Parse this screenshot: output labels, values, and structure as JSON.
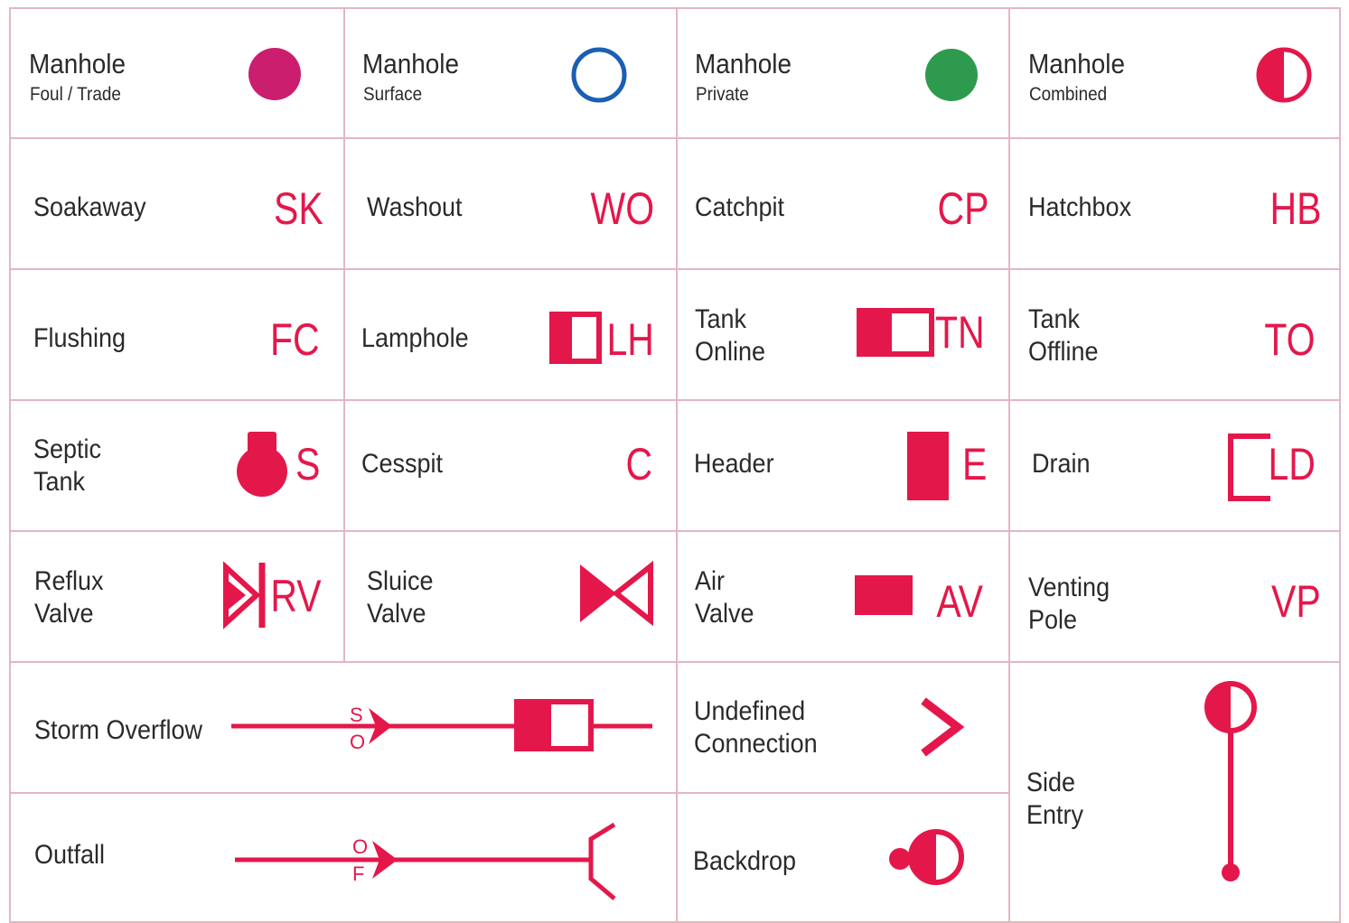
{
  "colors": {
    "symbol_red": "#e4174b",
    "foul_magenta": "#cc1e6e",
    "surface_blue": "#1a5fb4",
    "private_green": "#2e9a4e",
    "grid_line": "#e2b7c2",
    "text": "#2a2a2a"
  },
  "cells": {
    "manhole_foul": {
      "title": "Manhole",
      "subtitle": "Foul / Trade",
      "icon": "filled-circle-icon"
    },
    "manhole_surface": {
      "title": "Manhole",
      "subtitle": "Surface",
      "icon": "ring-circle-icon"
    },
    "manhole_private": {
      "title": "Manhole",
      "subtitle": "Private",
      "icon": "filled-circle-icon"
    },
    "manhole_combined": {
      "title": "Manhole",
      "subtitle": "Combined",
      "icon": "half-filled-circle-icon"
    },
    "soakaway": {
      "label": "Soakaway",
      "code": "SK"
    },
    "washout": {
      "label": "Washout",
      "code": "WO"
    },
    "catchpit": {
      "label": "Catchpit",
      "code": "CP"
    },
    "hatchbox": {
      "label": "Hatchbox",
      "code": "HB"
    },
    "flushing": {
      "label": "Flushing",
      "code": "FC"
    },
    "lamphole": {
      "label": "Lamphole",
      "code": "LH",
      "icon": "half-filled-square-icon"
    },
    "tank_online": {
      "label_line1": "Tank",
      "label_line2": "Online",
      "code": "TN",
      "icon": "half-filled-rect-icon"
    },
    "tank_offline": {
      "label_line1": "Tank",
      "label_line2": "Offline",
      "code": "TO"
    },
    "septic_tank": {
      "label_line1": "Septic",
      "label_line2": "Tank",
      "code": "S",
      "icon": "septic-bulb-icon"
    },
    "cesspit": {
      "label": "Cesspit",
      "code": "C"
    },
    "header": {
      "label": "Header",
      "code": "E",
      "icon": "filled-rect-icon"
    },
    "drain": {
      "label": "Drain",
      "code": "LD",
      "icon": "bracket-icon"
    },
    "reflux_valve": {
      "label_line1": "Reflux",
      "label_line2": "Valve",
      "code": "RV",
      "icon": "check-valve-icon"
    },
    "sluice_valve": {
      "label_line1": "Sluice",
      "label_line2": "Valve",
      "icon": "bowtie-valve-icon"
    },
    "air_valve": {
      "label_line1": "Air",
      "label_line2": "Valve",
      "code": "AV",
      "icon": "filled-rect-icon"
    },
    "venting_pole": {
      "label_line1": "Venting",
      "label_line2": "Pole",
      "code": "VP"
    },
    "storm_overflow": {
      "label": "Storm Overflow",
      "marker_top": "S",
      "marker_bottom": "O",
      "icon": "storm-overflow-line-icon"
    },
    "undefined_connection": {
      "label_line1": "Undefined",
      "label_line2": "Connection",
      "icon": "chevron-right-icon"
    },
    "side_entry": {
      "label_line1": "Side",
      "label_line2": "Entry",
      "icon": "side-entry-pin-icon"
    },
    "outfall": {
      "label": "Outfall",
      "marker_top": "O",
      "marker_bottom": "F",
      "icon": "outfall-line-icon"
    },
    "backdrop": {
      "label": "Backdrop",
      "icon": "backdrop-circle-icon"
    }
  }
}
